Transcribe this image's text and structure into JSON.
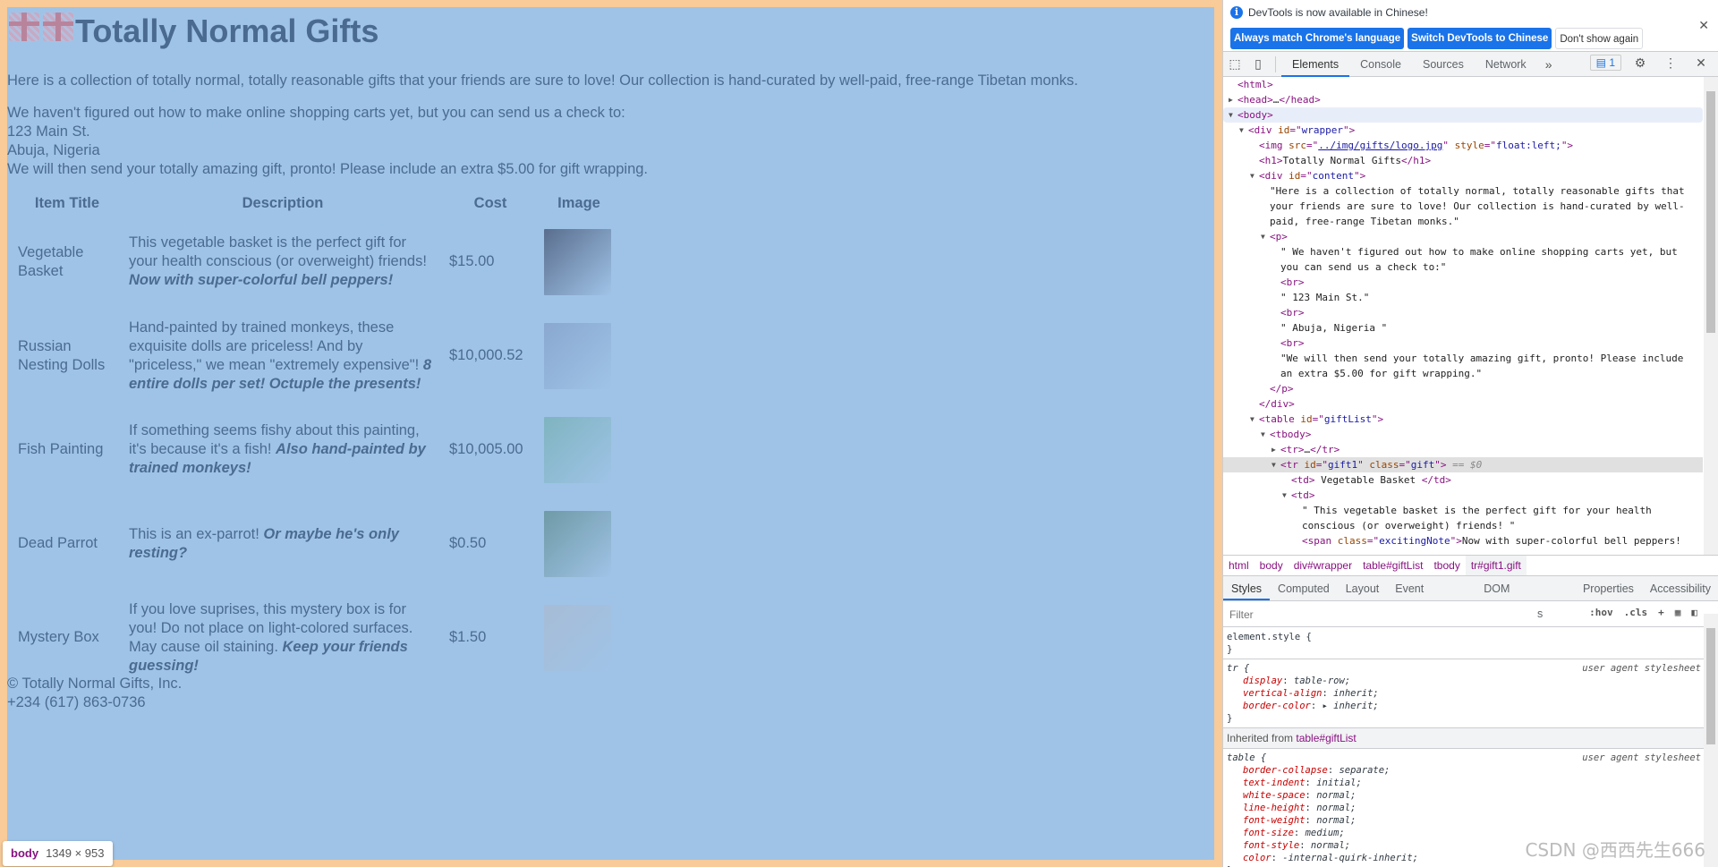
{
  "page": {
    "title": "Totally Normal Gifts",
    "intro": "Here is a collection of totally normal, totally reasonable gifts that your friends are sure to love! Our collection is hand-curated by well-paid, free-range Tibetan monks.",
    "check_lines": [
      "We haven't figured out how to make online shopping carts yet, but you can send us a check to:",
      "123 Main St.",
      "Abuja, Nigeria",
      "We will then send your totally amazing gift, pronto! Please include an extra $5.00 for gift wrapping."
    ],
    "table": {
      "headers": [
        "Item Title",
        "Description",
        "Cost",
        "Image"
      ],
      "rows": [
        {
          "title": "Vegetable Basket",
          "desc": "This vegetable basket is the perfect gift for your health conscious (or overweight) friends! ",
          "note": "Now with super-colorful bell peppers!",
          "cost": "$15.00",
          "img_color": "#5a6e8e"
        },
        {
          "title": "Russian Nesting Dolls",
          "desc": "Hand-painted by trained monkeys, these exquisite dolls are priceless! And by \"priceless,\" we mean \"extremely expensive\"! ",
          "note": "8 entire dolls per set! Octuple the presents!",
          "cost": "$10,000.52",
          "img_color": "#8aa8d0"
        },
        {
          "title": "Fish Painting",
          "desc": "If something seems fishy about this painting, it's because it's a fish! ",
          "note": "Also hand-painted by trained monkeys!",
          "cost": "$10,005.00",
          "img_color": "#7fb4c0"
        },
        {
          "title": "Dead Parrot",
          "desc": "This is an ex-parrot! ",
          "note": "Or maybe he's only resting?",
          "cost": "$0.50",
          "img_color": "#6f9aa6"
        },
        {
          "title": "Mystery Box",
          "desc": "If you love suprises, this mystery box is for you! Do not place on light-colored surfaces. May cause oil staining. ",
          "note": "Keep your friends guessing!",
          "cost": "$1.50",
          "img_color": "#a7bcd6"
        }
      ]
    },
    "footer": [
      "© Totally Normal Gifts, Inc.",
      "+234 (617) 863-0736"
    ],
    "tooltip": {
      "tag": "body",
      "size": "1349 × 953"
    },
    "colors": {
      "margin": "#f8cb98",
      "body": "#9fc3e7",
      "text": "#4b6b90"
    }
  },
  "devtools": {
    "info": "DevTools is now available in Chinese!",
    "buttons": [
      "Always match Chrome's language",
      "Switch DevTools to Chinese",
      "Don't show again"
    ],
    "tabs": [
      "Elements",
      "Console",
      "Sources",
      "Network"
    ],
    "issues_count": "1",
    "dom": [
      {
        "i": 0,
        "p": [
          [
            "tg",
            "<html>"
          ]
        ]
      },
      {
        "i": 0,
        "a": "r",
        "p": [
          [
            "tg",
            "<head>"
          ],
          [
            "tx",
            "…"
          ],
          [
            "tg",
            "</head>"
          ]
        ]
      },
      {
        "i": 0,
        "a": "d",
        "s": "bsel",
        "p": [
          [
            "tg",
            "<body>"
          ]
        ]
      },
      {
        "i": 1,
        "a": "d",
        "p": [
          [
            "tg",
            "<div "
          ],
          [
            "an",
            "id"
          ],
          [
            "tg",
            "=\""
          ],
          [
            "av",
            "wrapper"
          ],
          [
            "tg",
            "\">"
          ]
        ]
      },
      {
        "i": 2,
        "p": [
          [
            "tg",
            "<img "
          ],
          [
            "an",
            "src"
          ],
          [
            "tg",
            "=\""
          ],
          [
            "lk",
            "../img/gifts/logo.jpg"
          ],
          [
            "tg",
            "\" "
          ],
          [
            "an",
            "style"
          ],
          [
            "tg",
            "=\""
          ],
          [
            "av",
            "float:left;"
          ],
          [
            "tg",
            "\">"
          ]
        ]
      },
      {
        "i": 2,
        "p": [
          [
            "tg",
            "<h1>"
          ],
          [
            "tx",
            "Totally Normal Gifts"
          ],
          [
            "tg",
            "</h1>"
          ]
        ]
      },
      {
        "i": 2,
        "a": "d",
        "p": [
          [
            "tg",
            "<div "
          ],
          [
            "an",
            "id"
          ],
          [
            "tg",
            "=\""
          ],
          [
            "av",
            "content"
          ],
          [
            "tg",
            "\">"
          ]
        ]
      },
      {
        "i": 3,
        "p": [
          [
            "tx",
            "\"Here is a collection of totally normal, totally reasonable gifts that your friends are sure to love! Our collection is hand-curated by well-paid, free-range Tibetan monks.\""
          ]
        ]
      },
      {
        "i": 3,
        "a": "d",
        "p": [
          [
            "tg",
            "<p>"
          ]
        ]
      },
      {
        "i": 4,
        "p": [
          [
            "tx",
            "\" We haven't figured out how to make online shopping carts yet, but you can send us a check to:\""
          ]
        ]
      },
      {
        "i": 4,
        "p": [
          [
            "tg",
            "<br>"
          ]
        ]
      },
      {
        "i": 4,
        "p": [
          [
            "tx",
            "\" 123 Main St.\""
          ]
        ]
      },
      {
        "i": 4,
        "p": [
          [
            "tg",
            "<br>"
          ]
        ]
      },
      {
        "i": 4,
        "p": [
          [
            "tx",
            "\" Abuja, Nigeria \""
          ]
        ]
      },
      {
        "i": 4,
        "p": [
          [
            "tg",
            "<br>"
          ]
        ]
      },
      {
        "i": 4,
        "p": [
          [
            "tx",
            "\"We will then send your totally amazing gift, pronto! Please include an extra $5.00 for gift wrapping.\""
          ]
        ]
      },
      {
        "i": 3,
        "p": [
          [
            "tg",
            "</p>"
          ]
        ]
      },
      {
        "i": 2,
        "p": [
          [
            "tg",
            "</div>"
          ]
        ]
      },
      {
        "i": 2,
        "a": "d",
        "p": [
          [
            "tg",
            "<table "
          ],
          [
            "an",
            "id"
          ],
          [
            "tg",
            "=\""
          ],
          [
            "av",
            "giftList"
          ],
          [
            "tg",
            "\">"
          ]
        ]
      },
      {
        "i": 3,
        "a": "d",
        "p": [
          [
            "tg",
            "<tbody>"
          ]
        ]
      },
      {
        "i": 4,
        "a": "r",
        "p": [
          [
            "tg",
            "<tr>"
          ],
          [
            "tx",
            "…"
          ],
          [
            "tg",
            "</tr>"
          ]
        ]
      },
      {
        "i": 4,
        "a": "d",
        "s": "hl",
        "p": [
          [
            "tg",
            "<tr "
          ],
          [
            "an",
            "id"
          ],
          [
            "tg",
            "=\""
          ],
          [
            "av",
            "gift1"
          ],
          [
            "tg",
            "\" "
          ],
          [
            "an",
            "class"
          ],
          [
            "tg",
            "=\""
          ],
          [
            "av",
            "gift"
          ],
          [
            "tg",
            "\">"
          ],
          [
            "dim",
            " == $0"
          ]
        ]
      },
      {
        "i": 5,
        "p": [
          [
            "tg",
            "<td>"
          ],
          [
            "tx",
            " Vegetable Basket "
          ],
          [
            "tg",
            "</td>"
          ]
        ]
      },
      {
        "i": 5,
        "a": "d",
        "p": [
          [
            "tg",
            "<td>"
          ]
        ]
      },
      {
        "i": 6,
        "p": [
          [
            "tx",
            "\" This vegetable basket is the perfect gift for your health conscious (or overweight) friends! \""
          ]
        ]
      },
      {
        "i": 6,
        "p": [
          [
            "tg",
            "<span "
          ],
          [
            "an",
            "class"
          ],
          [
            "tg",
            "=\""
          ],
          [
            "av",
            "excitingNote"
          ],
          [
            "tg",
            "\">"
          ],
          [
            "tx",
            "Now with super-colorful bell peppers!"
          ]
        ]
      }
    ],
    "breadcrumbs": [
      "html",
      "body",
      "div#wrapper",
      "table#giftList",
      "tbody",
      "tr#gift1.gift"
    ],
    "style_tabs": [
      "Styles",
      "Computed",
      "Layout",
      "Event Listeners",
      "DOM Breakpoints",
      "Properties",
      "Accessibility"
    ],
    "filter_placeholder": "Filter",
    "filter_tools": [
      ":hov",
      ".cls",
      "+"
    ],
    "rules": [
      {
        "sel": "element.style {",
        "props": [],
        "src": ""
      },
      {
        "sel": "tr {",
        "src": "user agent stylesheet",
        "props": [
          [
            "display",
            "table-row;"
          ],
          [
            "vertical-align",
            "inherit;"
          ],
          [
            "border-color",
            "▸ inherit;"
          ]
        ]
      }
    ],
    "inherited": {
      "label": "Inherited from ",
      "from": "table#giftList"
    },
    "rule3": {
      "sel": "table {",
      "src": "user agent stylesheet",
      "props": [
        [
          "border-collapse",
          "separate;"
        ],
        [
          "text-indent",
          "initial;"
        ],
        [
          "white-space",
          "normal;"
        ],
        [
          "line-height",
          "normal;"
        ],
        [
          "font-weight",
          "normal;"
        ],
        [
          "font-size",
          "medium;"
        ],
        [
          "font-style",
          "normal;"
        ],
        [
          "color",
          "-internal-quirk-inherit;"
        ]
      ]
    },
    "watermark": "CSDN @西西先生666"
  }
}
